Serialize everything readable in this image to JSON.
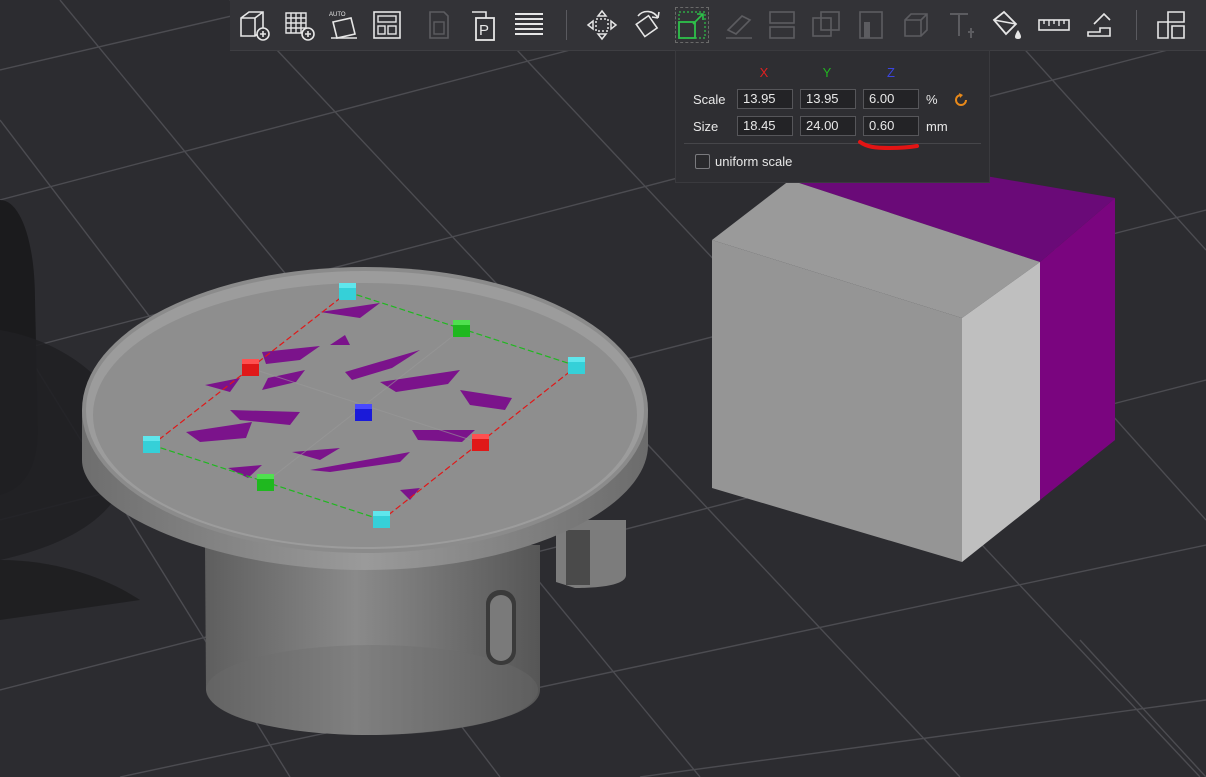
{
  "toolbar": {
    "items": [
      {
        "name": "add-object-icon"
      },
      {
        "name": "add-plate-icon"
      },
      {
        "name": "auto-arrange-icon",
        "label": "AUTO"
      },
      {
        "name": "arrange-layout-icon"
      },
      {
        "name": "orient-icon"
      },
      {
        "name": "plate-p-icon",
        "label": "P"
      },
      {
        "name": "slice-layers-icon"
      },
      {
        "name": "move-icon"
      },
      {
        "name": "rotate-icon"
      },
      {
        "name": "scale-icon"
      },
      {
        "name": "lay-on-face-icon"
      },
      {
        "name": "cut-icon"
      },
      {
        "name": "boolean-icon"
      },
      {
        "name": "support-paint-icon"
      },
      {
        "name": "seam-paint-icon"
      },
      {
        "name": "text-icon"
      },
      {
        "name": "color-paint-icon"
      },
      {
        "name": "measure-icon"
      },
      {
        "name": "assembly-icon"
      },
      {
        "name": "explode-icon"
      }
    ]
  },
  "scale_panel": {
    "axis_headers": {
      "x": "X",
      "y": "Y",
      "z": "Z"
    },
    "axis_colors": {
      "x": "#e02020",
      "y": "#22b322",
      "z": "#3b45e0"
    },
    "scale_label": "Scale",
    "size_label": "Size",
    "scale": {
      "x": "13.95",
      "y": "13.95",
      "z": "6.00",
      "unit": "%"
    },
    "size": {
      "x": "18.45",
      "y": "24.00",
      "z": "0.60",
      "unit": "mm"
    },
    "uniform_scale_label": "uniform scale",
    "uniform_scale_checked": false,
    "reset_color": "#e8891a"
  },
  "viewport": {
    "bed_color": "#2c2c30",
    "grid_color": "#4a4a4f",
    "object_color": "#8f8f8f",
    "paint_color": "#7e0f8e",
    "gizmo_colors": {
      "x": "#e01818",
      "y": "#1fb81f",
      "z": "#1a1ad9",
      "corner": "#35d0d8"
    }
  }
}
